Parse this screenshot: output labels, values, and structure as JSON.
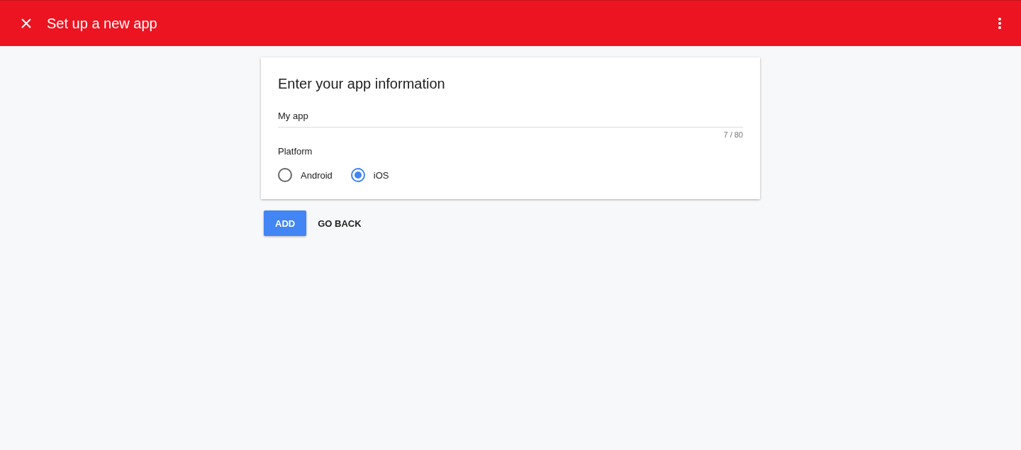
{
  "header": {
    "title": "Set up a new app"
  },
  "card": {
    "title": "Enter your app information",
    "field": {
      "value": "My app",
      "counter": "7 / 80"
    },
    "platform_label": "Platform",
    "options": [
      {
        "label": "Android",
        "selected": false
      },
      {
        "label": "iOS",
        "selected": true
      }
    ]
  },
  "buttons": [
    {
      "label": "ADD",
      "kind": "primary"
    },
    {
      "label": "GO BACK",
      "kind": "text"
    }
  ]
}
